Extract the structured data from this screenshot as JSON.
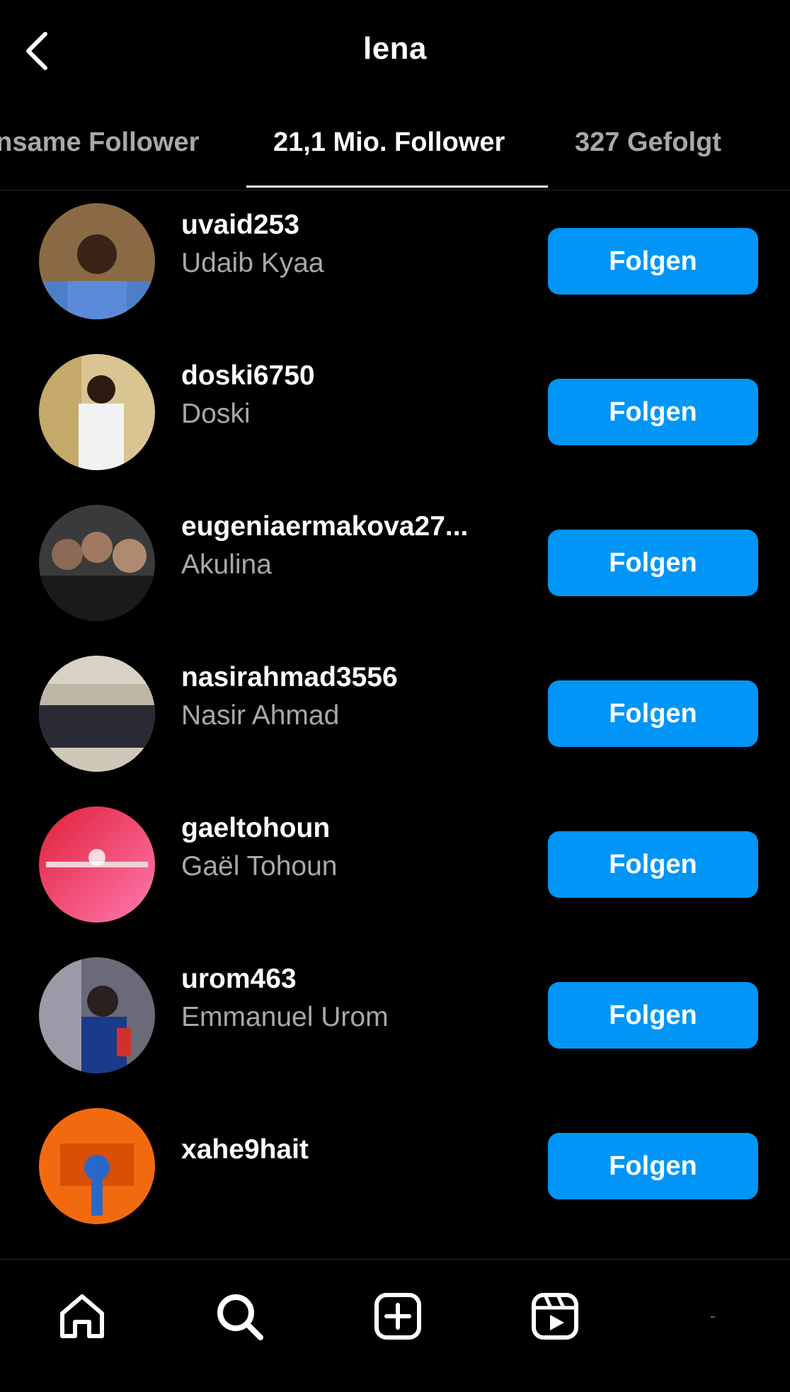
{
  "header": {
    "title": "lena"
  },
  "tabs": [
    {
      "label": "Gemeinsame Follower"
    },
    {
      "label": "21,1 Mio. Follower",
      "active": true
    },
    {
      "label": "327 Gefolgt"
    }
  ],
  "followers": [
    {
      "username": "uvaid253",
      "full_name": "Udaib Kyaa",
      "button": "Folgen"
    },
    {
      "username": "doski6750",
      "full_name": "Doski",
      "button": "Folgen"
    },
    {
      "username": "eugeniaermakova27...",
      "full_name": "Akulina",
      "button": "Folgen"
    },
    {
      "username": "nasirahmad3556",
      "full_name": "Nasir Ahmad",
      "button": "Folgen"
    },
    {
      "username": "gaeltohoun",
      "full_name": "Gaël Tohoun",
      "button": "Folgen"
    },
    {
      "username": "urom463",
      "full_name": "Emmanuel Urom",
      "button": "Folgen"
    },
    {
      "username": "xahe9hait",
      "full_name": "",
      "button": "Folgen"
    }
  ],
  "nav": {
    "items": [
      "home-icon",
      "search-icon",
      "add-post-icon",
      "reels-icon"
    ]
  },
  "colors": {
    "accent": "#0095f6",
    "background": "#000000",
    "secondary_text": "#a8a8a8"
  }
}
